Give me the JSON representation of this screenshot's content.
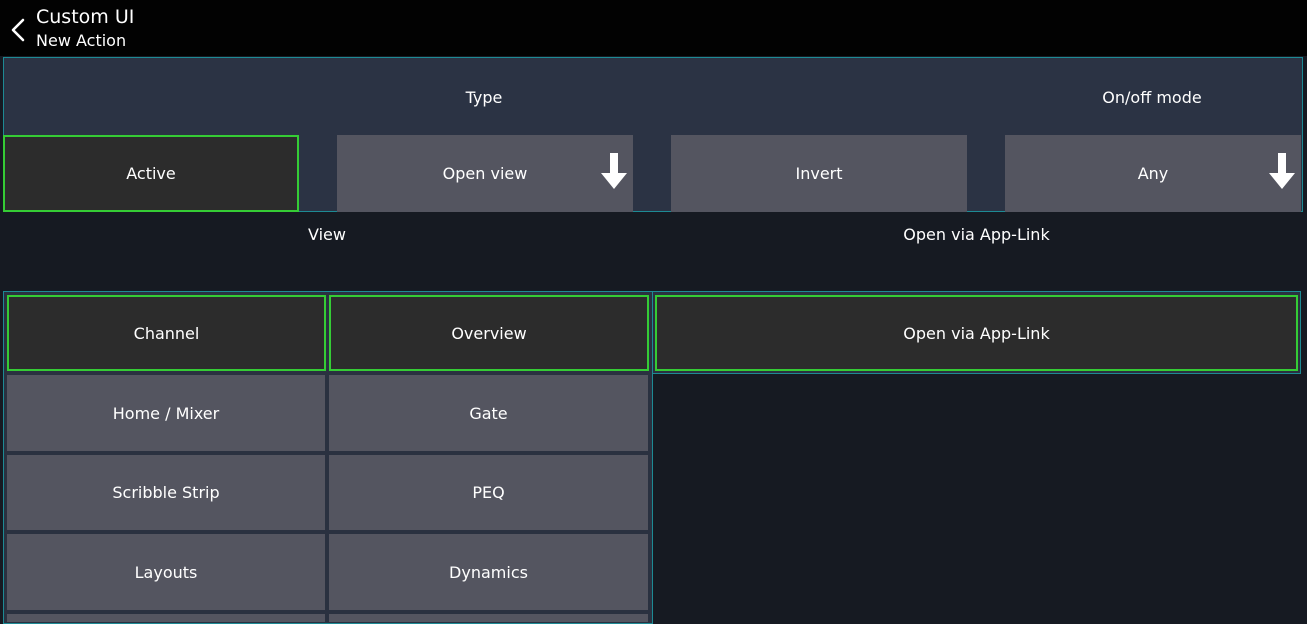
{
  "header": {
    "title": "Custom UI",
    "subtitle": "New Action"
  },
  "options": {
    "type_label": "Type",
    "onoff_label": "On/off mode",
    "active_button": "Active",
    "type_value": "Open view",
    "invert_button": "Invert",
    "onoff_value": "Any"
  },
  "sections": {
    "view_label": "View",
    "applink_label": "Open via App-Link"
  },
  "view": {
    "tabs": [
      "Channel",
      "Overview"
    ],
    "left_items": [
      "Home / Mixer",
      "Scribble Strip",
      "Layouts"
    ],
    "right_items": [
      "Gate",
      "PEQ",
      "Dynamics"
    ]
  },
  "applink": {
    "button": "Open via App-Link"
  },
  "colors": {
    "header_bg": "#020202",
    "panel_bg": "#2b3344",
    "panel_border": "#1d8a94",
    "button_gray": "#545560",
    "button_selected_bg": "#2c2c2c",
    "button_selected_border": "#35cc35"
  },
  "icons": {
    "back": "chevron-left-icon",
    "dropdown": "arrow-down-icon"
  }
}
